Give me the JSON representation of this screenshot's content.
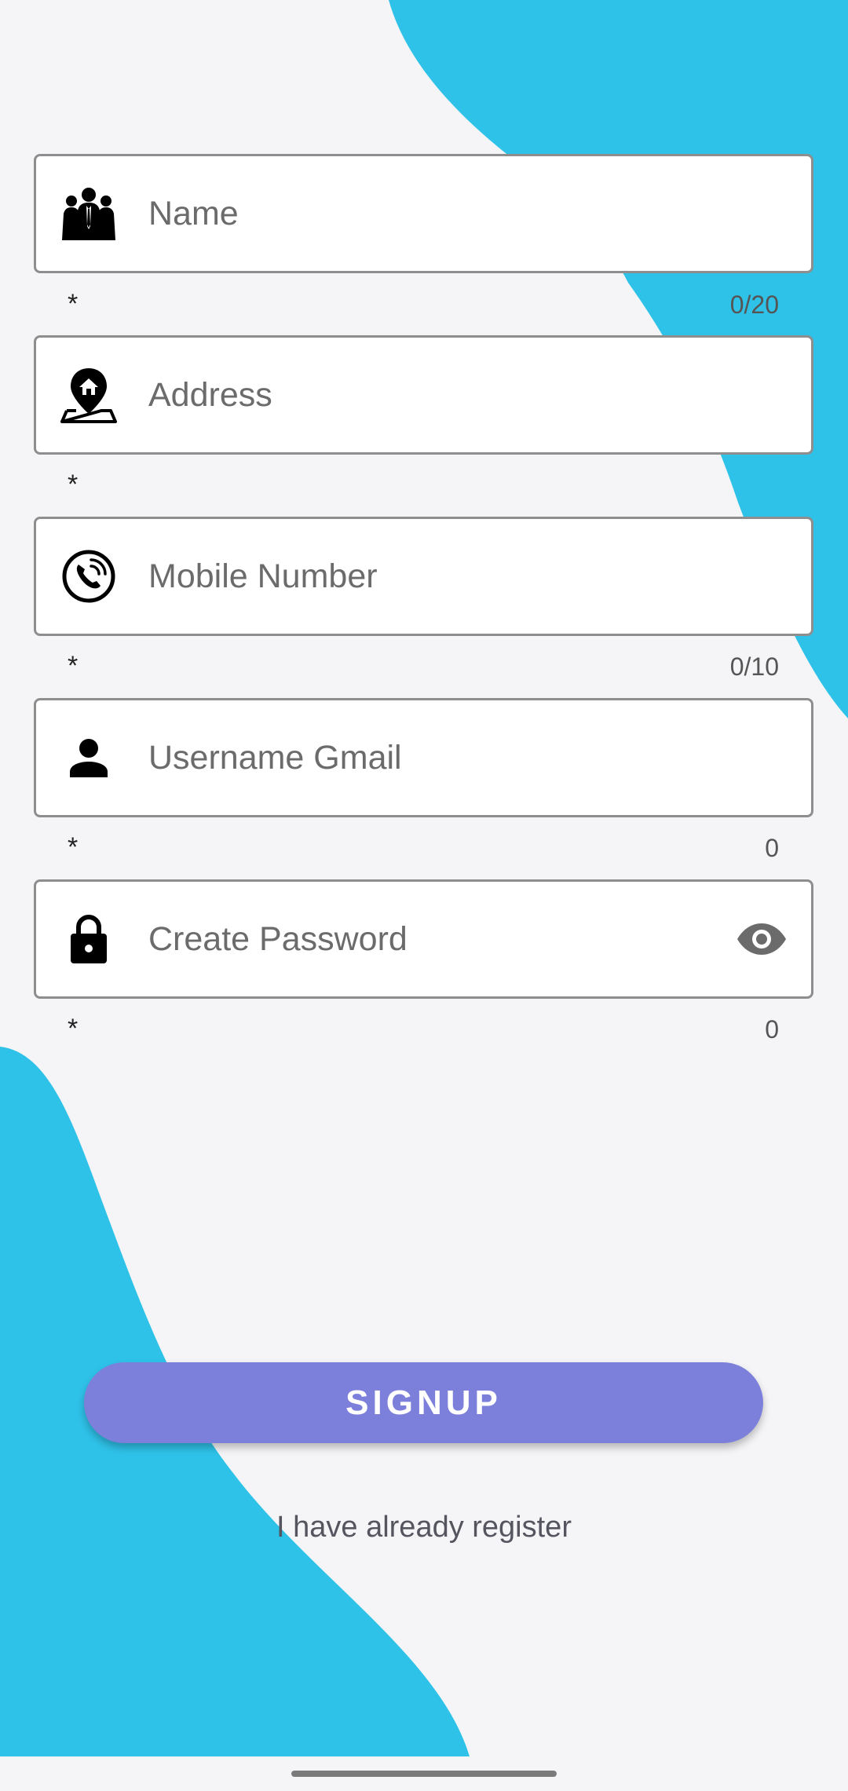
{
  "colors": {
    "background": "#f5f5f7",
    "blob": "#2fc2e9",
    "button": "#7d80da",
    "field_border": "#8e8e8e"
  },
  "fields": [
    {
      "placeholder": "Name",
      "icon": "people-group-icon",
      "required_mark": "*",
      "counter": "0/20"
    },
    {
      "placeholder": "Address",
      "icon": "home-location-pin-icon",
      "required_mark": "*",
      "counter": ""
    },
    {
      "placeholder": "Mobile Number",
      "icon": "phone-call-icon",
      "required_mark": "*",
      "counter": "0/10"
    },
    {
      "placeholder": "Username Gmail",
      "icon": "person-icon",
      "required_mark": "*",
      "counter": "0"
    },
    {
      "placeholder": "Create Password",
      "icon": "lock-icon",
      "required_mark": "*",
      "counter": "0",
      "trailing_icon": "eye-icon"
    }
  ],
  "signup_label": "SIGNUP",
  "login_link": "I have already register"
}
